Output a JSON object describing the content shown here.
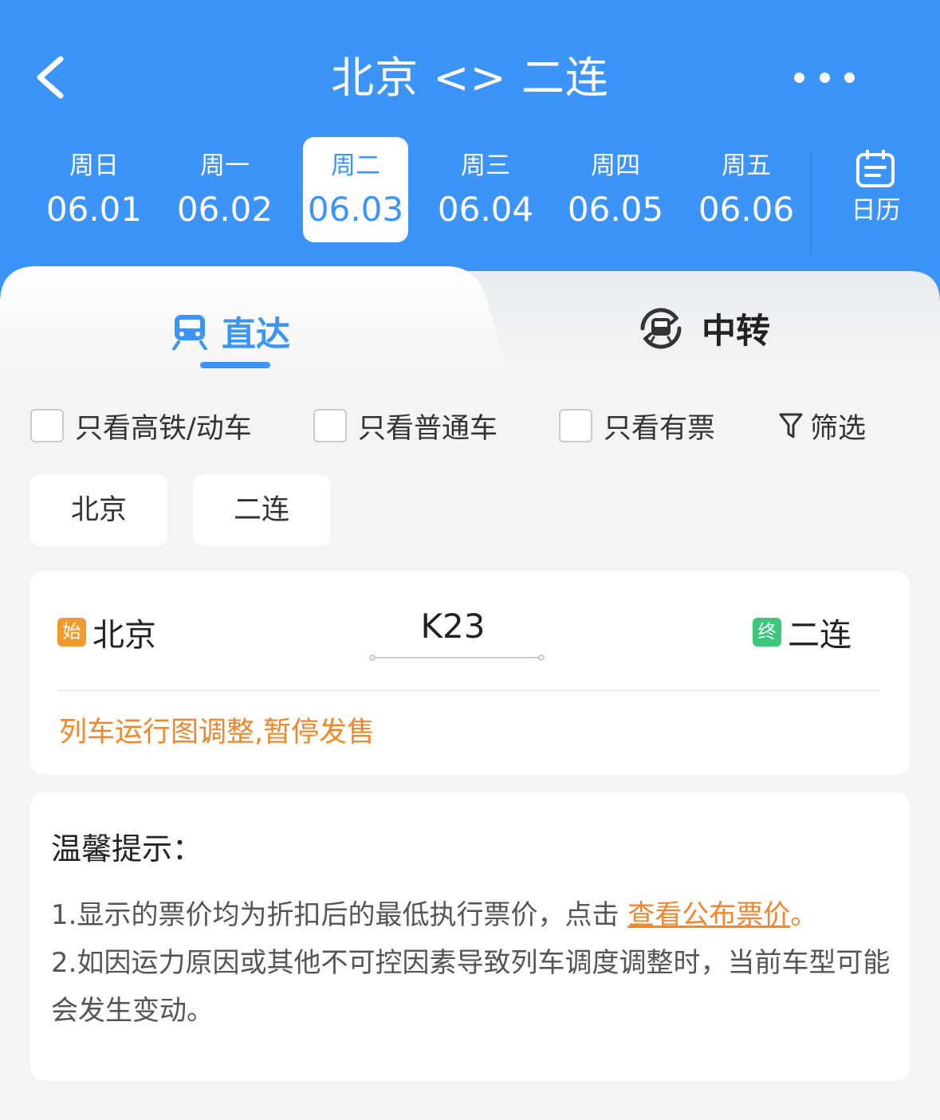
{
  "header": {
    "title": "北京 <> 二连"
  },
  "dates": [
    {
      "weekday": "周日",
      "date": "06.01",
      "active": false
    },
    {
      "weekday": "周一",
      "date": "06.02",
      "active": false
    },
    {
      "weekday": "周二",
      "date": "06.03",
      "active": true
    },
    {
      "weekday": "周三",
      "date": "06.04",
      "active": false
    },
    {
      "weekday": "周四",
      "date": "06.05",
      "active": false
    },
    {
      "weekday": "周五",
      "date": "06.06",
      "active": false
    }
  ],
  "calendar": {
    "label": "日历"
  },
  "tabs": {
    "direct": "直达",
    "transfer": "中转"
  },
  "filters": {
    "high_speed": "只看高铁/动车",
    "normal": "只看普通车",
    "available": "只看有票",
    "filter_label": "筛选"
  },
  "stations": {
    "from": "北京",
    "to": "二连"
  },
  "train": {
    "start_tag": "始",
    "from": "北京",
    "number": "K23",
    "end_tag": "终",
    "to": "二连",
    "status": "列车运行图调整,暂停发售"
  },
  "tips": {
    "title": "温馨提示：",
    "line1_prefix": "1.显示的票价均为折扣后的最低执行票价，点击 ",
    "line1_link": "查看公布票价",
    "line1_suffix": "。",
    "line2": "2.如因运力原因或其他不可控因素导致列车调度调整时，当前车型可能会发生变动。"
  },
  "colors": {
    "primary": "#3c94f8",
    "orange": "#f2862b",
    "green": "#3cc77c",
    "background": "#f4f4f4"
  }
}
